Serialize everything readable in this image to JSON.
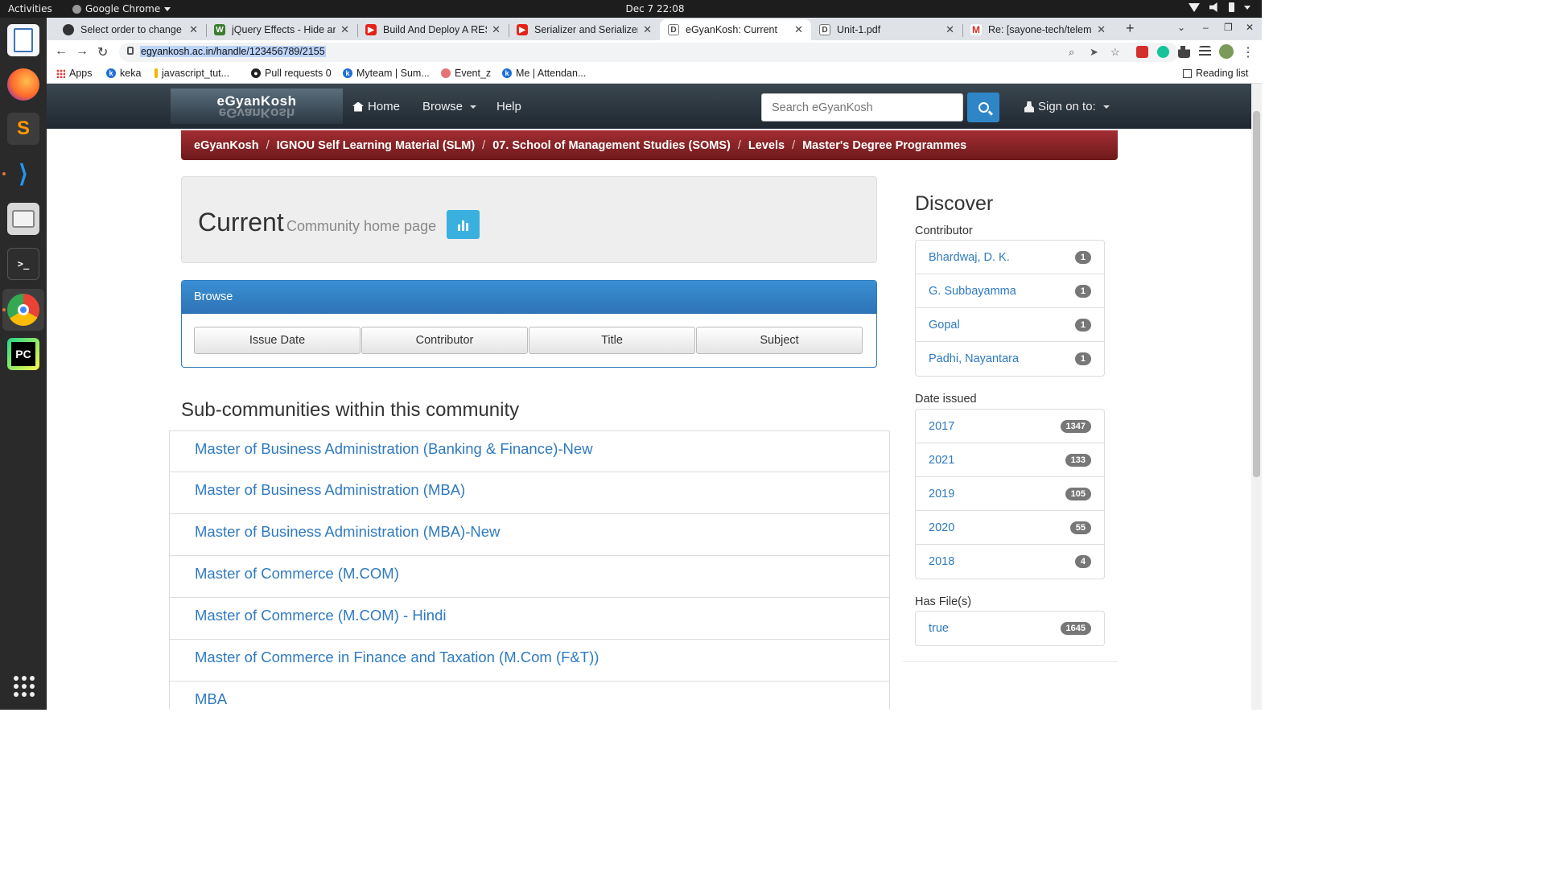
{
  "system": {
    "activities": "Activities",
    "app_name": "Google Chrome",
    "clock": "Dec 7  22:08"
  },
  "tabs": [
    {
      "title": "Select order to change | D",
      "favicon_color": "#333333"
    },
    {
      "title": "jQuery Effects - Hide and",
      "favicon_color": "#3b7d2f"
    },
    {
      "title": "Build And Deploy A REST",
      "favicon_color": "#e62117"
    },
    {
      "title": "Serializer and Serializer",
      "favicon_color": "#e62117"
    },
    {
      "title": "eGyanKosh: Current",
      "favicon_color": "#444444"
    },
    {
      "title": "Unit-1.pdf",
      "favicon_color": "#444444"
    },
    {
      "title": "Re: [sayone-tech/telem",
      "favicon_color": "#d93025"
    }
  ],
  "address_bar": {
    "url": "egyankosh.ac.in/handle/123456789/2155"
  },
  "bookmarks": [
    {
      "label": "Apps"
    },
    {
      "label": "keka"
    },
    {
      "label": "javascript_tut..."
    },
    {
      "label": "Pull requests 0"
    },
    {
      "label": "Myteam | Sum..."
    },
    {
      "label": "Event_z"
    },
    {
      "label": "Me | Attendan..."
    }
  ],
  "reading_list": "Reading list",
  "site": {
    "logo": "eGyanKosh",
    "nav": {
      "home": "Home",
      "browse": "Browse",
      "help": "Help",
      "sign_on": "Sign on to:"
    },
    "search_placeholder": "Search eGyanKosh"
  },
  "breadcrumb": [
    "eGyanKosh",
    "IGNOU Self Learning Material (SLM)",
    "07. School of Management Studies (SOMS)",
    "Levels",
    "Master's Degree Programmes"
  ],
  "header": {
    "title": "Current",
    "subtitle": "Community home page"
  },
  "browse": {
    "heading": "Browse",
    "buttons": [
      "Issue Date",
      "Contributor",
      "Title",
      "Subject"
    ]
  },
  "subcommunities": {
    "title": "Sub-communities within this community",
    "items": [
      "Master of Business Administration (Banking & Finance)-New",
      "Master of Business Administration (MBA)",
      "Master of Business Administration (MBA)-New",
      "Master of Commerce (M.COM)",
      "Master of Commerce (M.COM) - Hindi",
      "Master of Commerce in Finance and Taxation (M.Com (F&T))",
      "MBA"
    ]
  },
  "discover": {
    "title": "Discover",
    "contributor": {
      "label": "Contributor",
      "items": [
        {
          "name": "Bhardwaj, D. K.",
          "count": "1"
        },
        {
          "name": "G. Subbayamma",
          "count": "1"
        },
        {
          "name": "Gopal",
          "count": "1"
        },
        {
          "name": "Padhi, Nayantara",
          "count": "1"
        }
      ]
    },
    "date_issued": {
      "label": "Date issued",
      "items": [
        {
          "name": "2017",
          "count": "1347"
        },
        {
          "name": "2021",
          "count": "133"
        },
        {
          "name": "2019",
          "count": "105"
        },
        {
          "name": "2020",
          "count": "55"
        },
        {
          "name": "2018",
          "count": "4"
        }
      ]
    },
    "has_files": {
      "label": "Has File(s)",
      "items": [
        {
          "name": "true",
          "count": "1645"
        }
      ]
    }
  },
  "colors": {
    "breadcrumb_bg": "#8b2226",
    "link": "#2f7ac0",
    "panel_primary": "#2d73b5",
    "stats_button": "#3ab0de"
  }
}
